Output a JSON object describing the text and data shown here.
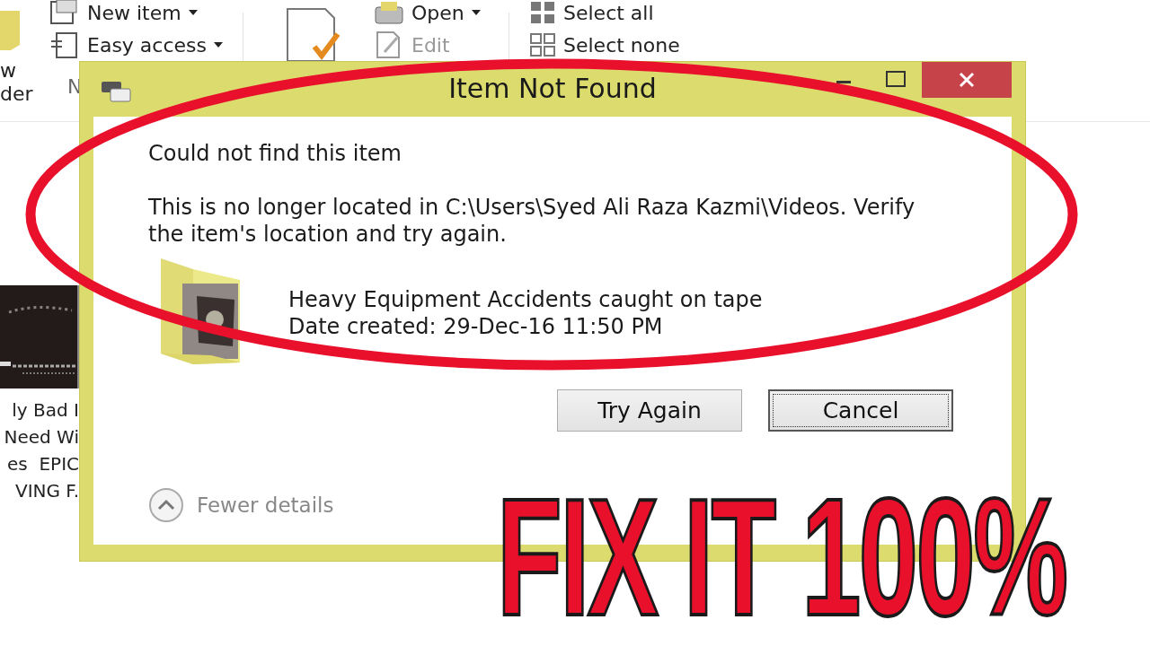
{
  "explorer": {
    "new_group": {
      "folder_label_lines": [
        "w",
        "der"
      ],
      "items": [
        {
          "label": "New item",
          "dropdown": true
        },
        {
          "label": "Easy access",
          "dropdown": true
        }
      ],
      "group_label": "N"
    },
    "open_group": {
      "items": [
        {
          "label": "Open",
          "dropdown": true,
          "disabled": false
        },
        {
          "label": "Edit",
          "dropdown": false,
          "disabled": true
        }
      ]
    },
    "select_group": {
      "items": [
        {
          "label": "Select all",
          "kind": "all"
        },
        {
          "label": "Select none",
          "kind": "none"
        }
      ]
    },
    "video": {
      "kind": "picture",
      "title_lines": [
        "ly Bad I",
        "Need Wi",
        "es  EPIC",
        "VING F."
      ]
    }
  },
  "dialog": {
    "title": "Item Not Found",
    "heading": "Could not find this item",
    "message": "This is no longer located in C:\\Users\\Syed Ali Raza Kazmi\\Videos. Verify the item's location and try again.",
    "item": {
      "name": "Heavy Equipment Accidents caught on tape",
      "date": "Date created: 29-Dec-16 11:50 PM"
    },
    "buttons": [
      {
        "label": "Try Again",
        "focused": false
      },
      {
        "label": "Cancel",
        "focused": true
      }
    ],
    "details_toggle": {
      "label": "Fewer details",
      "expanded": true
    }
  },
  "overlay": {
    "caption": "FIX IT 100%"
  }
}
